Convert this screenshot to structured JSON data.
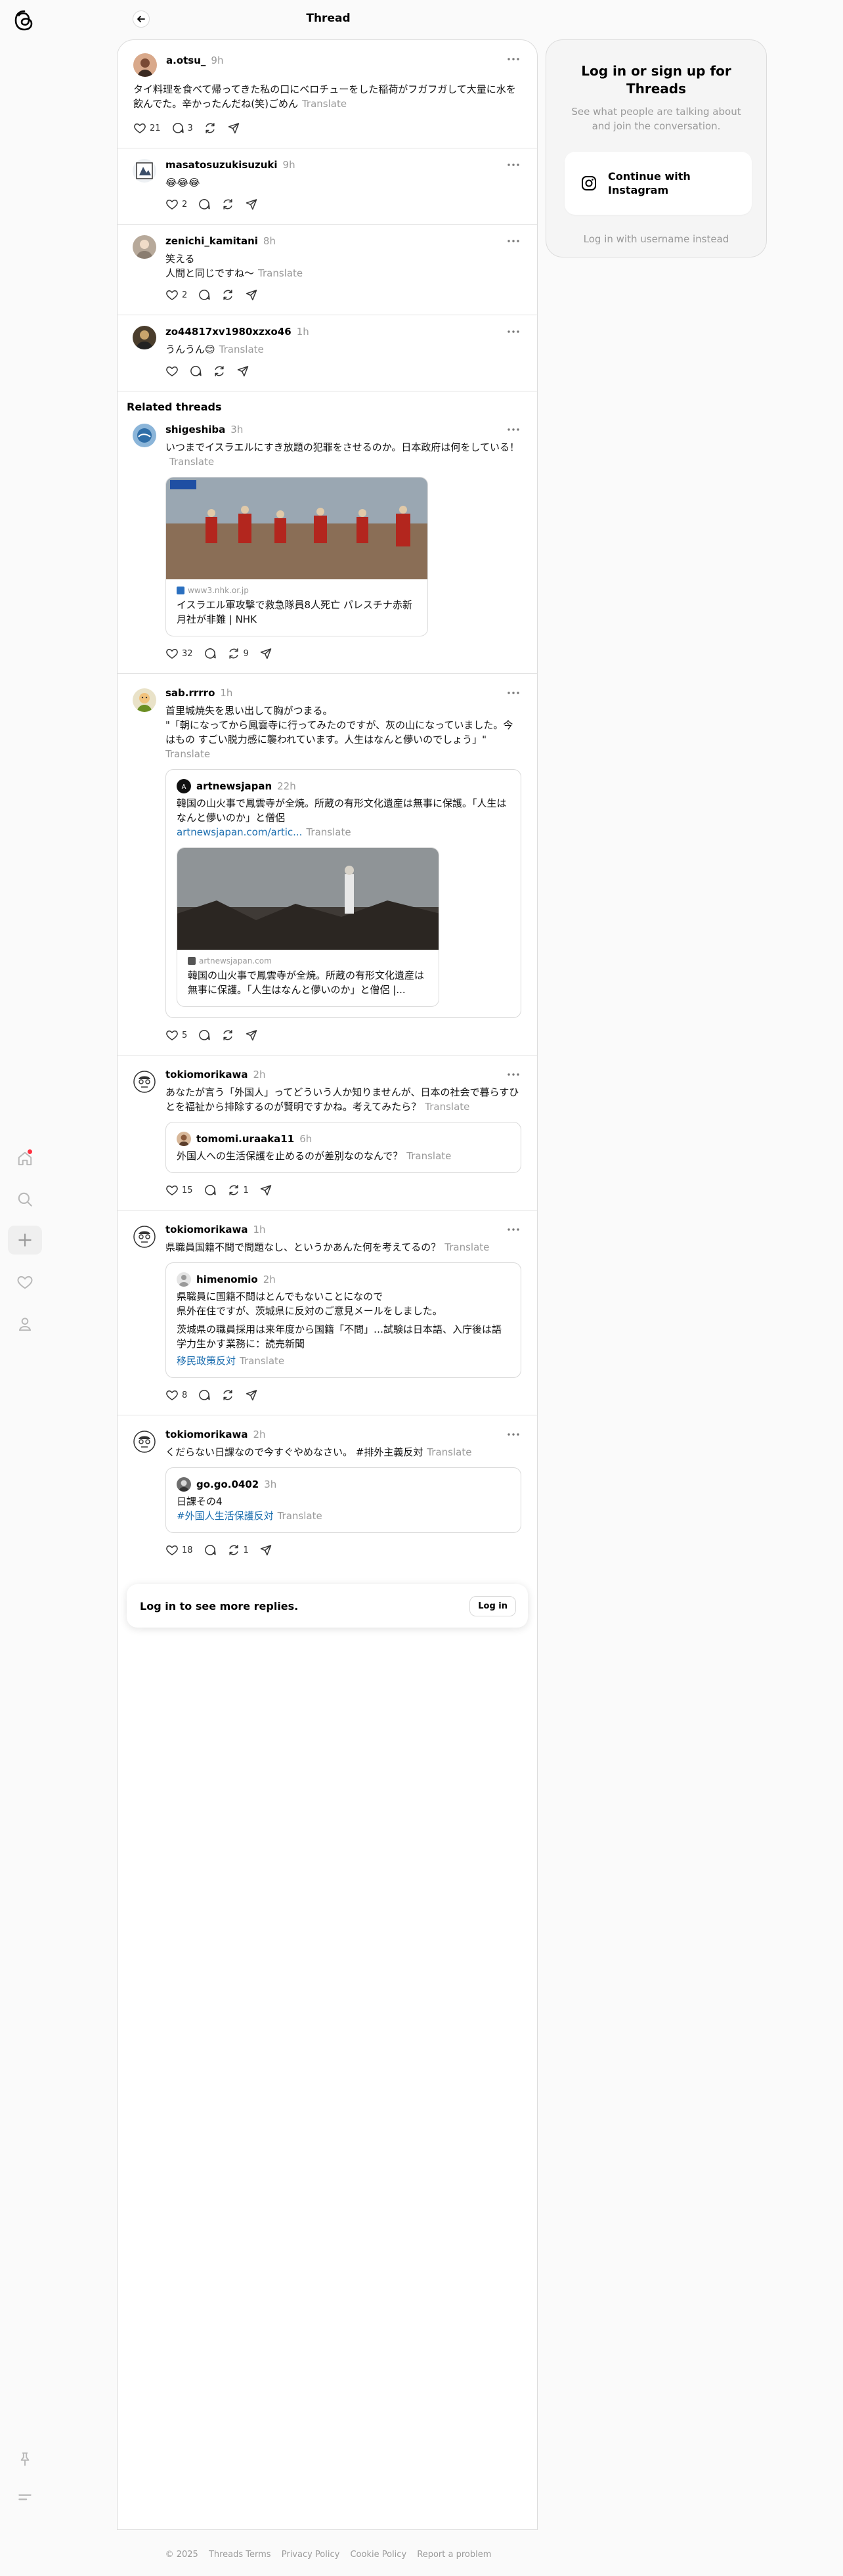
{
  "header": {
    "title": "Thread"
  },
  "main_post": {
    "username": "a.otsu_",
    "time": "9h",
    "text": "タイ料理を食べて帰ってきた私の口にベロチューをした稲荷がフガフガして大量に水を飲んでた。辛かったんだね(笑)ごめん",
    "translate": "Translate",
    "likes": "21",
    "replies": "3"
  },
  "replies": [
    {
      "username": "masatosuzukisuzuki",
      "time": "9h",
      "text": "😂😂😂",
      "likes": "2"
    },
    {
      "username": "zenichi_kamitani",
      "time": "8h",
      "text": "笑える\n人間と同じですね〜",
      "translate": "Translate",
      "likes": "2"
    },
    {
      "username": "zo44817xv1980xzxo46",
      "time": "1h",
      "text": "うんうん😊",
      "translate": "Translate"
    }
  ],
  "related": {
    "title": "Related threads",
    "posts": [
      {
        "username": "shigeshiba",
        "time": "3h",
        "text": "いつまでイスラエルにすき放題の犯罪をさせるのか。日本政府は何をしている！",
        "translate": "Translate",
        "link": {
          "domain": "www3.nhk.or.jp",
          "title": "イスラエル軍攻撃で救急隊員8人死亡 パレスチナ赤新月社が非難 | NHK"
        },
        "likes": "32",
        "reposts": "9"
      },
      {
        "username": "sab.rrrro",
        "time": "1h",
        "text": "首里城焼失を思い出して胸がつまる。\n\"「朝になってから鳳雲寺に行ってみたのですが、灰の山になっていました。今はもの すごい脱力感に襲われています。人生はなんと儚いのでしょう」\"",
        "translate": "Translate",
        "quote": {
          "username": "artnewsjapan",
          "time": "22h",
          "text": "韓国の山火事で鳳雲寺が全焼。所蔵の有形文化遺産は無事に保護。「人生はなんと儚いのか」と僧侶",
          "link_text": "artnewsjapan.com/artic...",
          "translate": "Translate",
          "card": {
            "domain": "artnewsjapan.com",
            "title": "韓国の山火事で鳳雲寺が全焼。所蔵の有形文化遺産は無事に保護。「人生はなんと儚いのか」と僧侶 |..."
          }
        },
        "likes": "5"
      },
      {
        "username": "tokiomorikawa",
        "time": "2h",
        "text": "あなたが言う「外国人」ってどういう人か知りませんが、日本の社会で暮らすひとを福祉から排除するのが賢明ですかね。考えてみたら？",
        "translate": "Translate",
        "quote": {
          "username": "tomomi.uraaka11",
          "time": "6h",
          "text": "外国人への生活保護を止めるのが差別なのなんで？",
          "translate": "Translate"
        },
        "likes": "15",
        "reposts": "1"
      },
      {
        "username": "tokiomorikawa",
        "time": "1h",
        "text": "県職員国籍不問で問題なし、というかあんた何を考えてるの？",
        "translate": "Translate",
        "quote": {
          "username": "himenomio",
          "time": "2h",
          "text": "県職員に国籍不問はとんでもないことになので\n県外在住ですが、茨城県に反対のご意見メールをしました。",
          "text2": "茨城県の職員採用は来年度から国籍「不問」…試験は日本語、入庁後は語学力生かす業務に：読売新聞",
          "tag": "移民政策反対",
          "translate": "Translate"
        },
        "likes": "8"
      },
      {
        "username": "tokiomorikawa",
        "time": "2h",
        "text": "くだらない日課なので今すぐやめなさい。 #排外主義反対",
        "translate": "Translate",
        "quote": {
          "username": "go.go.0402",
          "time": "3h",
          "text": "日課その4",
          "tag": "#外国人生活保護反対",
          "translate": "Translate"
        },
        "likes": "18",
        "reposts": "1"
      }
    ]
  },
  "login_prompt": {
    "text": "Log in to see more replies.",
    "button": "Log in"
  },
  "right_panel": {
    "title": "Log in or sign up for Threads",
    "subtitle": "See what people are talking about and join the conversation.",
    "instagram_button": "Continue with Instagram",
    "alt_login": "Log in with username instead"
  },
  "footer": [
    "© 2025",
    "Threads Terms",
    "Privacy Policy",
    "Cookie Policy",
    "Report a problem"
  ]
}
